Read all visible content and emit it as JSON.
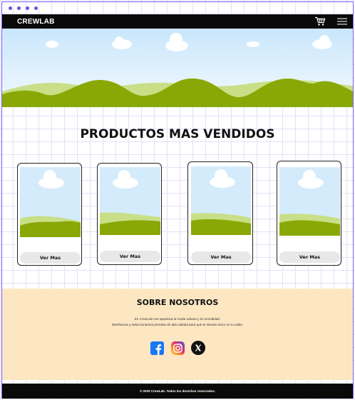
{
  "navbar": {
    "brand": "CREWLAB",
    "cart_icon": "shopping-cart-icon",
    "menu_icon": "hamburger-menu-icon"
  },
  "products": {
    "title": "PRODUCTOS MAS VENDIDOS",
    "cards": [
      {
        "button_label": "Ver Mas"
      },
      {
        "button_label": "Ver Mas"
      },
      {
        "button_label": "Ver Mas"
      },
      {
        "button_label": "Ver Mas"
      }
    ]
  },
  "about": {
    "title": "SOBRE NOSOTROS",
    "line1": "En CrewLab nos apasiona la moda urbana y la comodidad.",
    "line2": "Diseñamos y seleccionamos prendas de alta calidad para que te sientas único en tu estilo.",
    "socials": [
      "facebook-icon",
      "instagram-icon",
      "x-icon"
    ]
  },
  "footer": {
    "text": "© 2025 CrewLab. Todos los derechos reservados."
  },
  "colors": {
    "accent": "#7b5cff",
    "navbar": "#0a0a0a",
    "about_bg": "#fde7c3",
    "hill_dark": "#8aa805",
    "hill_light": "#c8df87"
  }
}
